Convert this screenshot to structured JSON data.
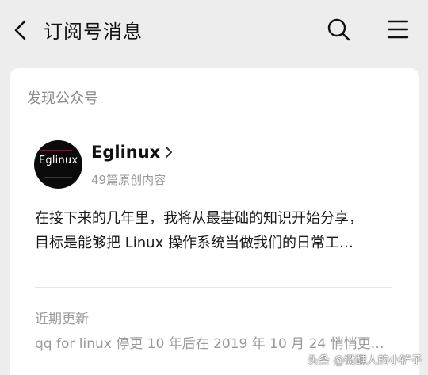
{
  "header": {
    "title": "订阅号消息",
    "back_icon": "back-chevron-icon",
    "search_icon": "search-icon",
    "menu_icon": "menu-icon"
  },
  "card": {
    "section_title": "发现公众号",
    "account": {
      "name": "Eglinux",
      "avatar_text": "Eglinux",
      "article_count": "49篇原创内容"
    },
    "intro_lines": [
      "在接下来的几年里，我将从最基础的知识开始分享，",
      "目标是能够把 Linux 操作系统当做我们的日常工…"
    ],
    "recent_label": "近期更新",
    "recent_item": "qq for linux 停更 10 年后在 2019 年 10 月 24 悄悄更…"
  },
  "watermark": "头条 @微醺人的小铲子",
  "colors": {
    "background": "#ededed",
    "card": "#ffffff",
    "secondary_text": "#9a9a9a"
  }
}
